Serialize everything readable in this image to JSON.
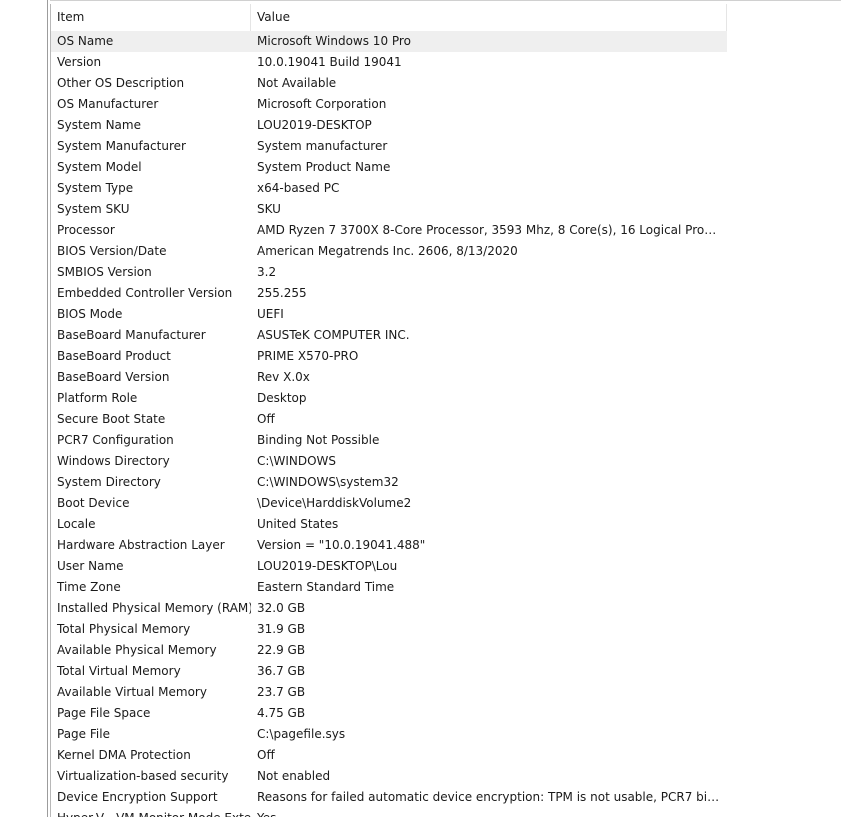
{
  "table": {
    "headers": {
      "item": "Item",
      "value": "Value"
    },
    "rows": [
      {
        "item": "OS Name",
        "value": "Microsoft Windows 10 Pro"
      },
      {
        "item": "Version",
        "value": "10.0.19041 Build 19041"
      },
      {
        "item": "Other OS Description",
        "value": "Not Available"
      },
      {
        "item": "OS Manufacturer",
        "value": "Microsoft Corporation"
      },
      {
        "item": "System Name",
        "value": "LOU2019-DESKTOP"
      },
      {
        "item": "System Manufacturer",
        "value": "System manufacturer"
      },
      {
        "item": "System Model",
        "value": "System Product Name"
      },
      {
        "item": "System Type",
        "value": "x64-based PC"
      },
      {
        "item": "System SKU",
        "value": "SKU"
      },
      {
        "item": "Processor",
        "value": "AMD Ryzen 7 3700X 8-Core Processor, 3593 Mhz, 8 Core(s), 16 Logical Proce..."
      },
      {
        "item": "BIOS Version/Date",
        "value": "American Megatrends Inc. 2606, 8/13/2020"
      },
      {
        "item": "SMBIOS Version",
        "value": "3.2"
      },
      {
        "item": "Embedded Controller Version",
        "value": "255.255"
      },
      {
        "item": "BIOS Mode",
        "value": "UEFI"
      },
      {
        "item": "BaseBoard Manufacturer",
        "value": "ASUSTeK COMPUTER INC."
      },
      {
        "item": "BaseBoard Product",
        "value": "PRIME X570-PRO"
      },
      {
        "item": "BaseBoard Version",
        "value": "Rev X.0x"
      },
      {
        "item": "Platform Role",
        "value": "Desktop"
      },
      {
        "item": "Secure Boot State",
        "value": "Off"
      },
      {
        "item": "PCR7 Configuration",
        "value": "Binding Not Possible"
      },
      {
        "item": "Windows Directory",
        "value": "C:\\WINDOWS"
      },
      {
        "item": "System Directory",
        "value": "C:\\WINDOWS\\system32"
      },
      {
        "item": "Boot Device",
        "value": "\\Device\\HarddiskVolume2"
      },
      {
        "item": "Locale",
        "value": "United States"
      },
      {
        "item": "Hardware Abstraction Layer",
        "value": "Version = \"10.0.19041.488\""
      },
      {
        "item": "User Name",
        "value": "LOU2019-DESKTOP\\Lou"
      },
      {
        "item": "Time Zone",
        "value": "Eastern Standard Time"
      },
      {
        "item": "Installed Physical Memory (RAM)",
        "value": "32.0 GB"
      },
      {
        "item": "Total Physical Memory",
        "value": "31.9 GB"
      },
      {
        "item": "Available Physical Memory",
        "value": "22.9 GB"
      },
      {
        "item": "Total Virtual Memory",
        "value": "36.7 GB"
      },
      {
        "item": "Available Virtual Memory",
        "value": "23.7 GB"
      },
      {
        "item": "Page File Space",
        "value": "4.75 GB"
      },
      {
        "item": "Page File",
        "value": "C:\\pagefile.sys"
      },
      {
        "item": "Kernel DMA Protection",
        "value": "Off"
      },
      {
        "item": "Virtualization-based security",
        "value": "Not enabled"
      },
      {
        "item": "Device Encryption Support",
        "value": "Reasons for failed automatic device encryption: TPM is not usable, PCR7 bindi..."
      },
      {
        "item": "Hyper-V - VM Monitor Mode Extensions",
        "value": "Yes"
      }
    ]
  }
}
